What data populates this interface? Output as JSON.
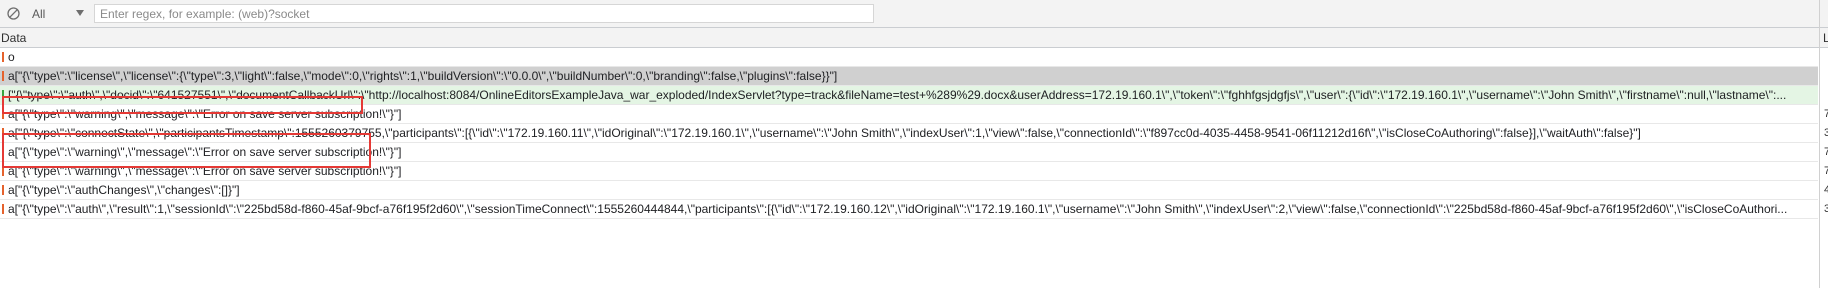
{
  "toolbar": {
    "clear_icon": "clear-icon",
    "filter_type": "All",
    "dropdown_icon": "caret-down-icon",
    "search_placeholder": "Enter regex, for example: (web)?socket",
    "search_value": ""
  },
  "grid": {
    "columns": [
      "Data",
      "L"
    ],
    "rows": [
      {
        "direction": "received",
        "text": "o",
        "length": ""
      },
      {
        "direction": "received",
        "text": "a[\"{\\\"type\\\":\\\"license\\\",\\\"license\\\":{\\\"type\\\":3,\\\"light\\\":false,\\\"mode\\\":0,\\\"rights\\\":1,\\\"buildVersion\\\":\\\"0.0.0\\\",\\\"buildNumber\\\":0,\\\"branding\\\":false,\\\"plugins\\\":false}}\"]",
        "length": "",
        "selected": "grey"
      },
      {
        "direction": "sent",
        "text": "[\"{\\\"type\\\":\\\"auth\\\",\\\"docid\\\":\\\"641527551\\\",\\\"documentCallbackUrl\\\":\\\"http://localhost:8084/OnlineEditorsExampleJava_war_exploded/IndexServlet?type=track&fileName=test+%289%29.docx&userAddress=172.19.160.1\\\",\\\"token\\\":\\\"fghhfgsjdgfjs\\\",\\\"user\\\":{\\\"id\\\":\\\"172.19.160.1\\\",\\\"username\\\":\\\"John Smith\\\",\\\"firstname\\\":null,\\\"lastname\\\":...",
        "length": "",
        "selected": "green"
      },
      {
        "direction": "received",
        "text": "a[\"{\\\"type\\\":\\\"warning\\\",\\\"message\\\":\\\"Error on save server subscription!\\\"}\"]",
        "length": "7"
      },
      {
        "direction": "received",
        "text": "a[\"{\\\"type\\\":\\\"connectState\\\",\\\"participantsTimestamp\\\":1555260379755,\\\"participants\\\":[{\\\"id\\\":\\\"172.19.160.11\\\",\\\"idOriginal\\\":\\\"172.19.160.1\\\",\\\"username\\\":\\\"John Smith\\\",\\\"indexUser\\\":1,\\\"view\\\":false,\\\"connectionId\\\":\\\"f897cc0d-4035-4458-9541-06f11212d16f\\\",\\\"isCloseCoAuthoring\\\":false}],\\\"waitAuth\\\":false}\"]",
        "length": "3"
      },
      {
        "direction": "received",
        "text": "a[\"{\\\"type\\\":\\\"warning\\\",\\\"message\\\":\\\"Error on save server subscription!\\\"}\"]",
        "length": "7"
      },
      {
        "direction": "received",
        "text": "a[\"{\\\"type\\\":\\\"warning\\\",\\\"message\\\":\\\"Error on save server subscription!\\\"}\"]",
        "length": "7"
      },
      {
        "direction": "received",
        "text": "a[\"{\\\"type\\\":\\\"authChanges\\\",\\\"changes\\\":[]}\"]",
        "length": "4"
      },
      {
        "direction": "received",
        "text": "a[\"{\\\"type\\\":\\\"auth\\\",\\\"result\\\":1,\\\"sessionId\\\":\\\"225bd58d-f860-45af-9bcf-a76f195f2d60\\\",\\\"sessionTimeConnect\\\":1555260444844,\\\"participants\\\":[{\\\"id\\\":\\\"172.19.160.12\\\",\\\"idOriginal\\\":\\\"172.19.160.1\\\",\\\"username\\\":\\\"John Smith\\\",\\\"indexUser\\\":2,\\\"view\\\":false,\\\"connectionId\\\":\\\"225bd58d-f860-45af-9bcf-a76f195f2d60\\\",\\\"isCloseCoAuthori...",
        "length": "3"
      }
    ]
  },
  "colors": {
    "received_marker": "#e5622d",
    "sent_marker": "#36a33f",
    "highlight": "#e53935",
    "selected_grey": "#d0d0d0",
    "selected_green": "#e4f5e4"
  }
}
